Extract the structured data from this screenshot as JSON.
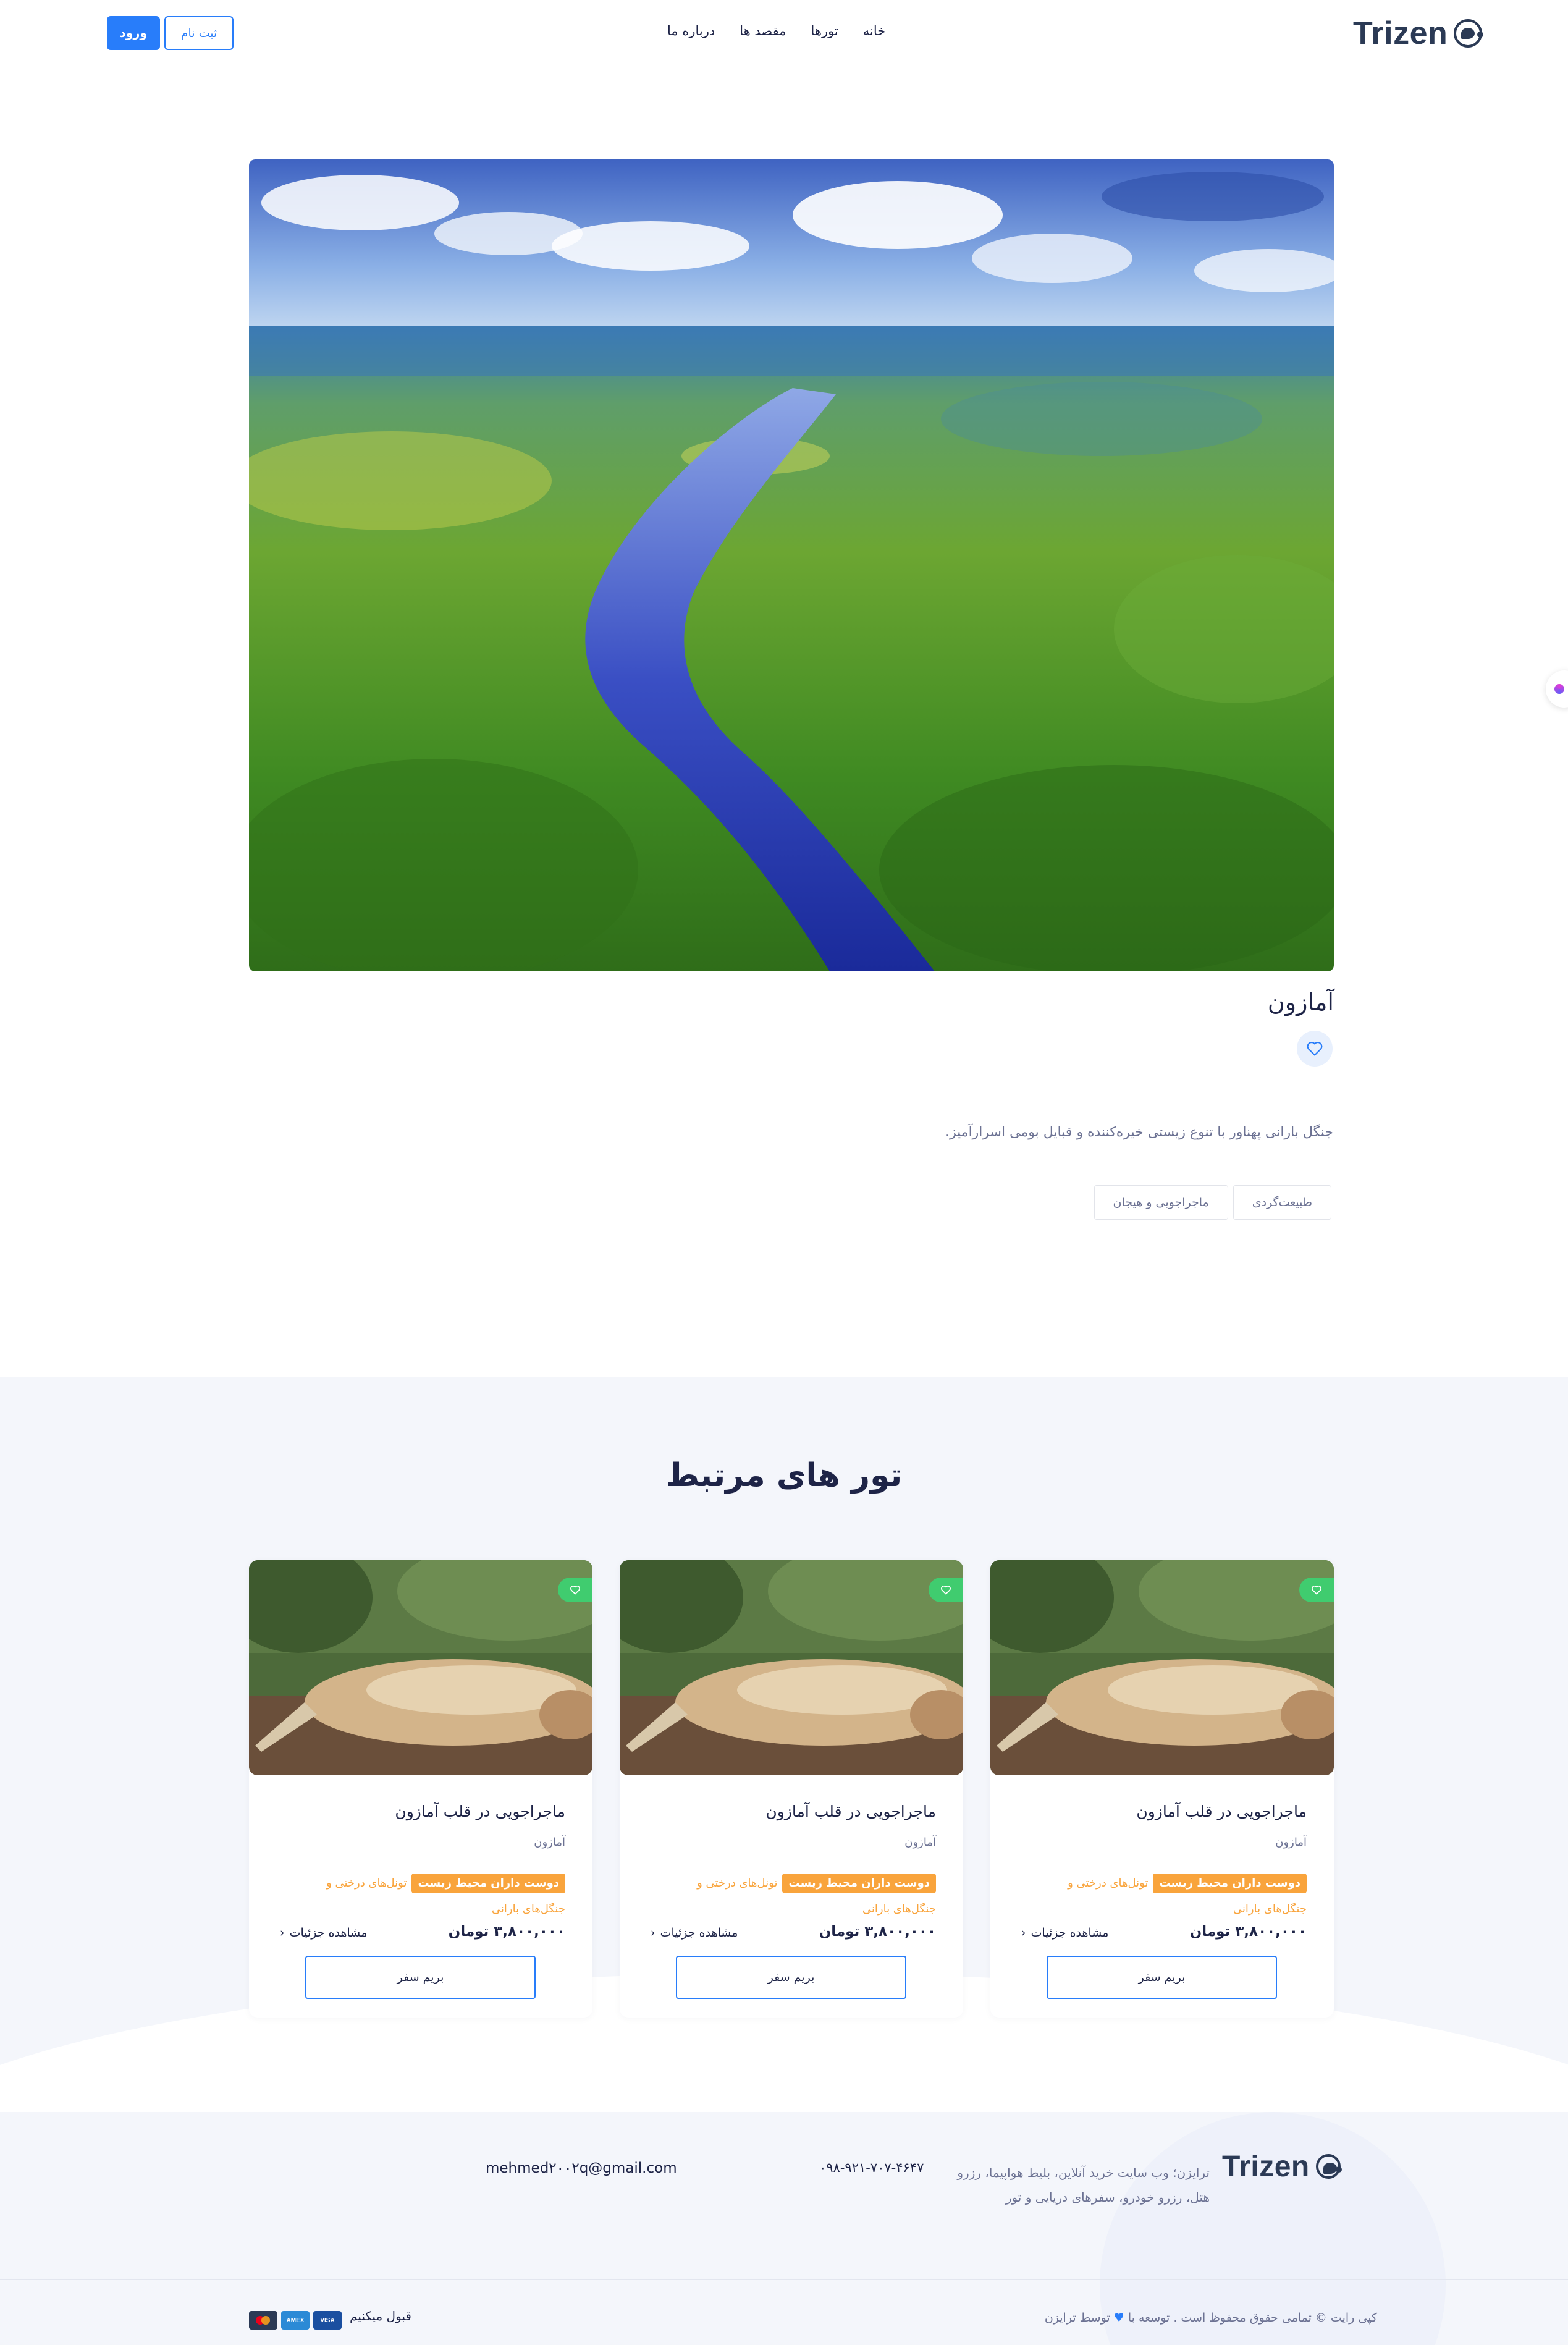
{
  "header": {
    "logo_text": "Trizen",
    "nav": [
      "خانه",
      "تورها",
      "مقصد ها",
      "درباره ما"
    ],
    "login_label": "ورود",
    "register_label": "ثبت نام"
  },
  "destination": {
    "title": "آمازون",
    "description": "جنگل بارانی پهناور با تنوع زیستی خیره‌کننده و قبایل بومی اسرارآمیز.",
    "tags": [
      "طبیعت‌گردی",
      "ماجراجویی و هیجان"
    ]
  },
  "related": {
    "title": "تور های مرتبط",
    "cards": [
      {
        "title": "ماجراجویی در قلب آمازون",
        "location": "آمازون",
        "badge": "دوست داران محیط زیست",
        "extra": "تونل‌های درختی و جنگل‌های بارانی",
        "price": "۳,۸۰۰,۰۰۰ تومان",
        "details": "مشاهده جزئیات",
        "cta": "بریم سفر"
      },
      {
        "title": "ماجراجویی در قلب آمازون",
        "location": "آمازون",
        "badge": "دوست داران محیط زیست",
        "extra": "تونل‌های درختی و جنگل‌های بارانی",
        "price": "۳,۸۰۰,۰۰۰ تومان",
        "details": "مشاهده جزئیات",
        "cta": "بریم سفر"
      },
      {
        "title": "ماجراجویی در قلب آمازون",
        "location": "آمازون",
        "badge": "دوست داران محیط زیست",
        "extra": "تونل‌های درختی و جنگل‌های بارانی",
        "price": "۳,۸۰۰,۰۰۰ تومان",
        "details": "مشاهده جزئیات",
        "cta": "بریم سفر"
      }
    ]
  },
  "footer": {
    "logo_text": "Trizen",
    "about": "ترایزن؛ وب سایت خرید آنلاین، بلیط هواپیما، رزرو هتل، رزرو خودرو، سفرهای دریایی و تور",
    "phone": "۰۹۸-۹۲۱-۷۰۷-۴۶۴۷",
    "email": "mehmed۲۰۰۲q@gmail.com",
    "copyright_pre": "کپی رایت © تمامی حقوق محفوظ است . توسعه با",
    "copyright_post": "توسط ترایزن",
    "accept_label": "قبول میکنیم",
    "payments": [
      "VISA",
      "AMEX",
      "MC"
    ]
  },
  "colors": {
    "primary": "#287dfa",
    "dark": "#1e2447",
    "muted": "#6c7293",
    "badge": "#f9a43c",
    "fav": "#40cc6f",
    "section_bg": "#f4f6fb"
  }
}
